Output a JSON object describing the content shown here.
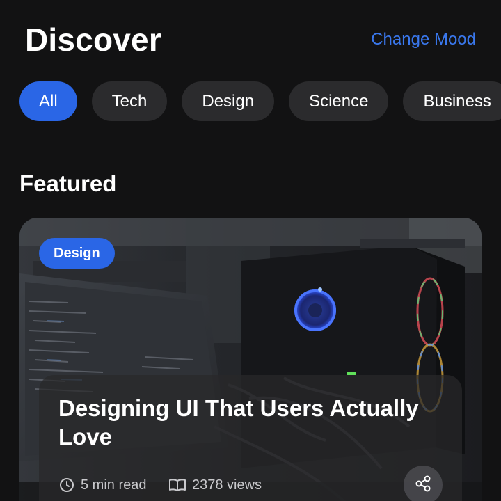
{
  "header": {
    "title": "Discover",
    "mood_link": "Change Mood"
  },
  "categories": [
    {
      "label": "All",
      "active": true
    },
    {
      "label": "Tech",
      "active": false
    },
    {
      "label": "Design",
      "active": false
    },
    {
      "label": "Science",
      "active": false
    },
    {
      "label": "Business",
      "active": false
    }
  ],
  "featured": {
    "section_title": "Featured",
    "card": {
      "category": "Design",
      "title": "Designing UI That Users Actually Love",
      "read_time": "5 min read",
      "views": "2378 views",
      "image_icon": "computer-setup-photo",
      "share_icon": "share-icon"
    }
  },
  "colors": {
    "background": "#121213",
    "accent": "#2a66e6",
    "link": "#3a78ee",
    "chip": "#2b2b2d"
  }
}
